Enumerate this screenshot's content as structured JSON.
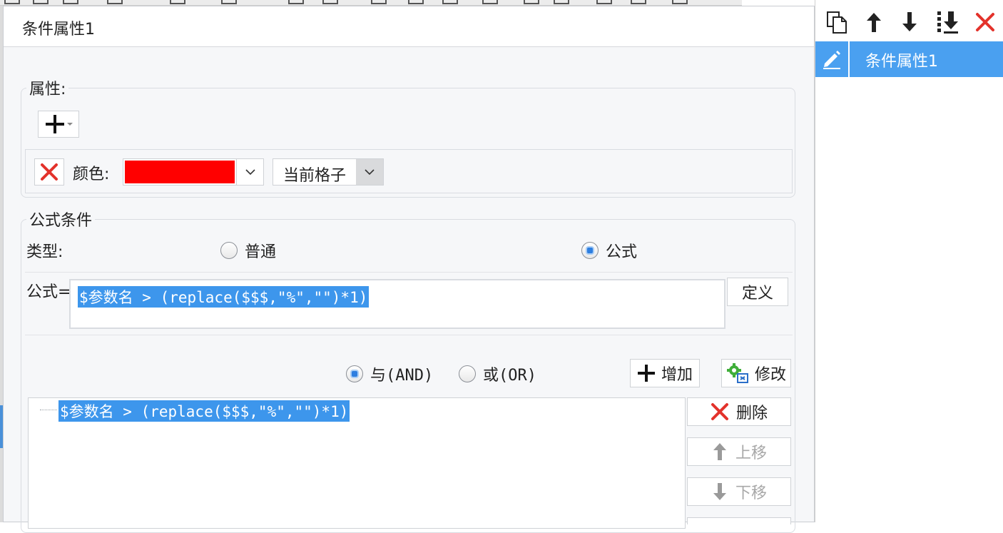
{
  "dialog": {
    "title": "条件属性1",
    "properties": {
      "legend": "属性:",
      "color_label": "颜色:",
      "color_value": "#ff0000",
      "scope_value": "当前格子"
    },
    "formula_condition": {
      "legend": "公式条件",
      "type_label": "类型:",
      "type_options": [
        "普通",
        "公式"
      ],
      "type_selected": "公式",
      "formula_label": "公式=",
      "formula_value": "$参数名 > (replace($$$,\"%\",\"\")*1)",
      "define_button": "定义",
      "logic_options": [
        "与(AND)",
        "或(OR)"
      ],
      "logic_selected": "与(AND)",
      "add_button": "增加",
      "modify_button": "修改",
      "conditions": [
        "$参数名 > (replace($$$,\"%\",\"\")*1)"
      ],
      "delete_button": "删除",
      "move_up_button": "上移",
      "move_down_button": "下移"
    }
  },
  "right_panel": {
    "items": [
      "条件属性1"
    ],
    "selected": "条件属性1",
    "toolbar_icons": [
      "copy-icon",
      "move-up-icon",
      "move-down-icon",
      "move-bottom-icon",
      "delete-icon"
    ]
  },
  "colors": {
    "accent": "#3d96ec",
    "selected_row": "#4aa0f0",
    "delete_red": "#e3322b"
  }
}
